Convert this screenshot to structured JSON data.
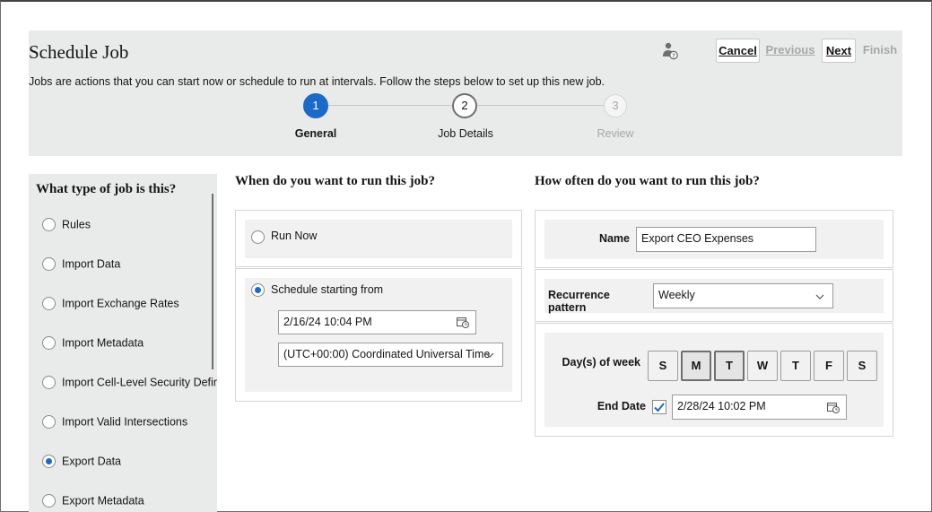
{
  "header": {
    "title": "Schedule Job",
    "subtitle": "Jobs are actions that you can start now or schedule to run at intervals. Follow the steps below to set up this new job.",
    "buttons": {
      "cancel": "Cancel",
      "previous": "Previous",
      "next": "Next",
      "finish": "Finish"
    },
    "steps": [
      {
        "number": "1",
        "label": "General",
        "state": "current"
      },
      {
        "number": "2",
        "label": "Job Details",
        "state": "upcoming"
      },
      {
        "number": "3",
        "label": "Review",
        "state": "disabled"
      }
    ]
  },
  "job_type": {
    "heading": "What type of job is this?",
    "items": [
      {
        "label": "Rules",
        "checked": false
      },
      {
        "label": "Import Data",
        "checked": false
      },
      {
        "label": "Import Exchange Rates",
        "checked": false
      },
      {
        "label": "Import Metadata",
        "checked": false
      },
      {
        "label": "Import Cell-Level Security Definitions",
        "checked": false
      },
      {
        "label": "Import Valid Intersections",
        "checked": false
      },
      {
        "label": "Export Data",
        "checked": true
      },
      {
        "label": "Export Metadata",
        "checked": false
      }
    ]
  },
  "when": {
    "heading": "When do you want to run this job?",
    "run_now": "Run Now",
    "schedule_label": "Schedule starting from",
    "start_datetime": "2/16/24 10:04 PM",
    "timezone": "(UTC+00:00) Coordinated Universal Time"
  },
  "how_often": {
    "heading": "How often do you want to run this job?",
    "name_label": "Name",
    "name_value": "Export CEO Expenses",
    "recurrence_label": "Recurrence pattern",
    "recurrence_value": "Weekly",
    "days_label": "Day(s) of week",
    "days": [
      {
        "label": "S",
        "selected": false
      },
      {
        "label": "M",
        "selected": true
      },
      {
        "label": "T",
        "selected": true
      },
      {
        "label": "W",
        "selected": false
      },
      {
        "label": "T",
        "selected": false
      },
      {
        "label": "F",
        "selected": false
      },
      {
        "label": "S",
        "selected": false
      }
    ],
    "end_date_label": "End Date",
    "end_date_checked": true,
    "end_datetime": "2/28/24 10:02 PM"
  },
  "colors": {
    "accent": "#1b6ac9",
    "panel": "#e9eaea",
    "disabled": "#a7a7a7"
  },
  "icons": [
    "help-user-icon",
    "calendar-clock-icon",
    "chevron-down-icon",
    "checkmark-icon"
  ]
}
